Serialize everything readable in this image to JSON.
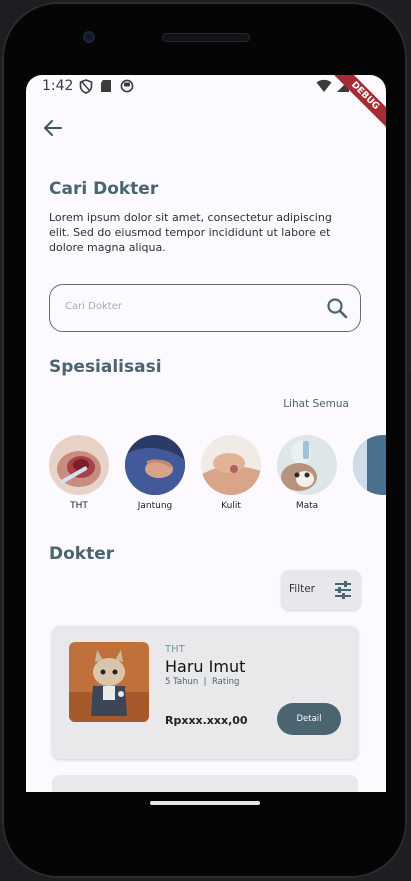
{
  "status_bar": {
    "time": "1:42",
    "debug_banner": "DEBUG"
  },
  "header": {
    "title": "Cari Dokter",
    "description": "Lorem ipsum dolor sit amet, consectetur adipiscing elit. Sed do eiusmod tempor incididunt ut labore et dolore magna aliqua."
  },
  "search": {
    "placeholder": "Cari Dokter"
  },
  "specialization": {
    "title": "Spesialisasi",
    "see_all": "Lihat Semua",
    "items": [
      {
        "label": "THT"
      },
      {
        "label": "Jantung"
      },
      {
        "label": "Kulit"
      },
      {
        "label": "Mata"
      }
    ]
  },
  "doctors": {
    "title": "Dokter",
    "filter_label": "Filter",
    "list": [
      {
        "specialty": "THT",
        "name": "Haru Imut",
        "experience": "5 Tahun",
        "rating_label": "Rating",
        "price": "Rpxxx.xxx,00",
        "detail_label": "Detail"
      }
    ]
  },
  "colors": {
    "accent": "#4a6470",
    "card_bg": "#e9e9ec",
    "background": "#fdfaff"
  }
}
